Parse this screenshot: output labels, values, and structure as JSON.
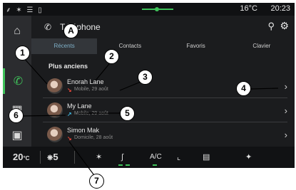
{
  "status_bar": {
    "left_icons": "⸙ ✶ ☰ ▯",
    "weather": "16°C",
    "time": "20:23"
  },
  "header": {
    "title": "Téléphone",
    "phone_icon": "phone-icon",
    "search_icon": "search-icon",
    "settings_icon": "gear-icon"
  },
  "tabs": [
    {
      "label": "Récents",
      "active": true
    },
    {
      "label": "Contacts",
      "active": false
    },
    {
      "label": "Favoris",
      "active": false
    },
    {
      "label": "Clavier",
      "active": false
    }
  ],
  "section": {
    "heading": "Plus anciens"
  },
  "contacts": [
    {
      "name": "Enorah Lane",
      "call_type": "missed",
      "call_icon": "↘",
      "detail": "Mobile, 29 août"
    },
    {
      "name": "My Lane",
      "call_type": "outgoing",
      "call_icon": "↗",
      "detail": "Mobile, 29 août"
    },
    {
      "name": "Simon Mak",
      "call_type": "missed",
      "call_icon": "↘",
      "detail": "Domicile, 28 août"
    }
  ],
  "call_colors": {
    "missed": "#e0463a",
    "outgoing": "#3fb0d8"
  },
  "climate": {
    "temperature": "20",
    "temperature_unit": "°C",
    "fan_speed": "5",
    "ac_label": "A/C"
  },
  "callouts": [
    "1",
    "2",
    "3",
    "4",
    "5",
    "6",
    "7",
    "A"
  ],
  "accent_color": "#3fc25a"
}
